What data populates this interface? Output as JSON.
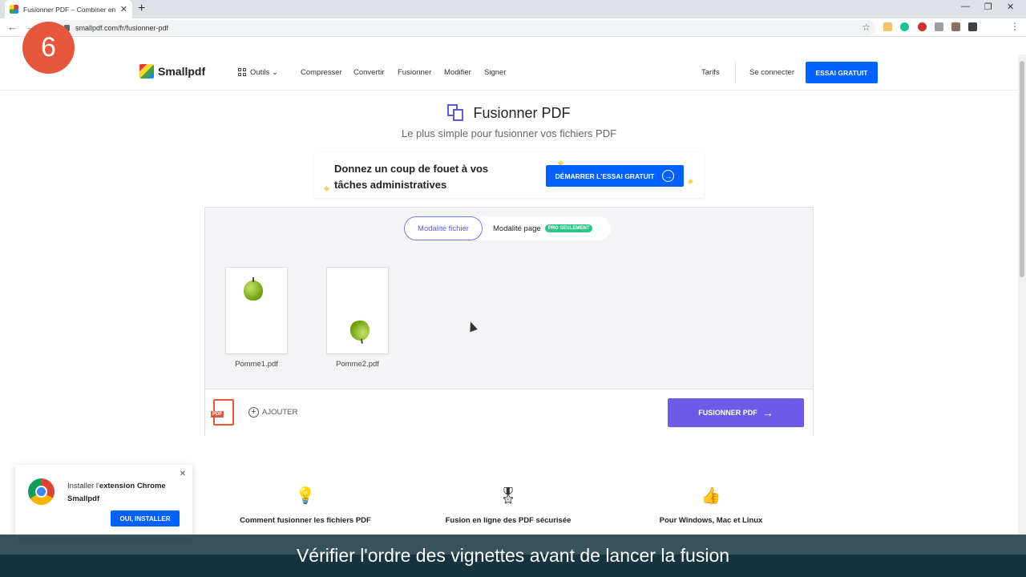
{
  "browser": {
    "tab_title": "Fusionner PDF – Combiner en lig",
    "url": "smallpdf.com/fr/fusionner-pdf"
  },
  "step": "6",
  "site": {
    "brand": "Smallpdf",
    "nav": {
      "tools": "Outils",
      "compress": "Compresser",
      "convert": "Convertir",
      "merge": "Fusionner",
      "edit": "Modifier",
      "sign": "Signer"
    },
    "pricing": "Tarifs",
    "login": "Se connecter",
    "trial": "ESSAI GRATUIT"
  },
  "page": {
    "title": "Fusionner PDF",
    "subtitle": "Le plus simple pour fusionner vos fichiers PDF"
  },
  "promo": {
    "text": "Donnez un coup de fouet à vos tâches administratives",
    "button": "DÉMARRER L'ESSAI GRATUIT"
  },
  "tool": {
    "mode_file": "Modalité fichier",
    "mode_page": "Modalité page",
    "pro_badge": "PRO SEULEMENT",
    "files": [
      {
        "name": "Pomme1.pdf"
      },
      {
        "name": "Pomme2.pdf"
      }
    ],
    "add": "AJOUTER",
    "merge": "FUSIONNER PDF"
  },
  "features": [
    {
      "title": "Comment fusionner les fichiers PDF",
      "icon": "lightbulb-icon"
    },
    {
      "title": "Fusion en ligne des PDF sécurisée",
      "icon": "award-icon"
    },
    {
      "title": "Pour Windows, Mac et Linux",
      "icon": "thumbs-up-icon"
    }
  ],
  "extension_popup": {
    "text_prefix": "Installer l'",
    "text_bold": "extension Chrome Smallpdf",
    "button": "OUI, INSTALLER"
  },
  "caption": "Vérifier l'ordre des vignettes avant de lancer la fusion",
  "colors": {
    "primary_blue": "#0061fe",
    "merge_purple": "#6d5ae6",
    "badge_orange": "#e5573d",
    "pro_green": "#2bc587"
  }
}
